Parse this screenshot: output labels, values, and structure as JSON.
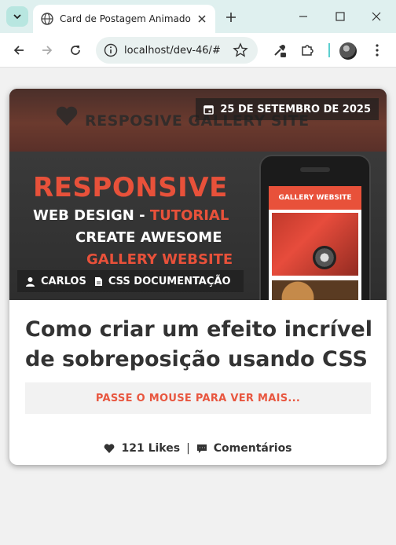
{
  "browser": {
    "tab_title": "Card de Postagem Animado",
    "url": "localhost/dev-46/#"
  },
  "card": {
    "image_text": {
      "banner": "RESPOSIVE GALLERY SITE",
      "line1": "RESPONSIVE",
      "line2_a": "WEB DESIGN - ",
      "line2_b": "TUTORIAL",
      "line3": "CREATE  AWESOME",
      "line4": "GALLERY WEBSITE",
      "phone_header": "GALLERY WEBSITE"
    },
    "date": "25 DE SETEMBRO DE 2025",
    "author": "CARLOS",
    "category": "CSS DOCUMENTAÇÃO",
    "title": "Como criar um efeito incrível de sobreposição usando CSS",
    "hover_hint": "PASSE O MOUSE PARA VER MAIS...",
    "likes": "121 Likes",
    "separator": "|",
    "comments": "Comentários"
  },
  "colors": {
    "accent": "#e8563f",
    "text": "#333333",
    "tabstrip": "#dff0ef"
  },
  "icons": [
    "chevron-down-icon",
    "globe-icon",
    "close-icon",
    "plus-icon",
    "minimize-icon",
    "maximize-icon",
    "back-icon",
    "forward-icon",
    "reload-icon",
    "info-icon",
    "star-icon",
    "extension-puzzle-icon",
    "eyedropper-icon",
    "menu-dots-icon",
    "calendar-icon",
    "user-icon",
    "document-icon",
    "heart-icon",
    "comment-icon"
  ]
}
